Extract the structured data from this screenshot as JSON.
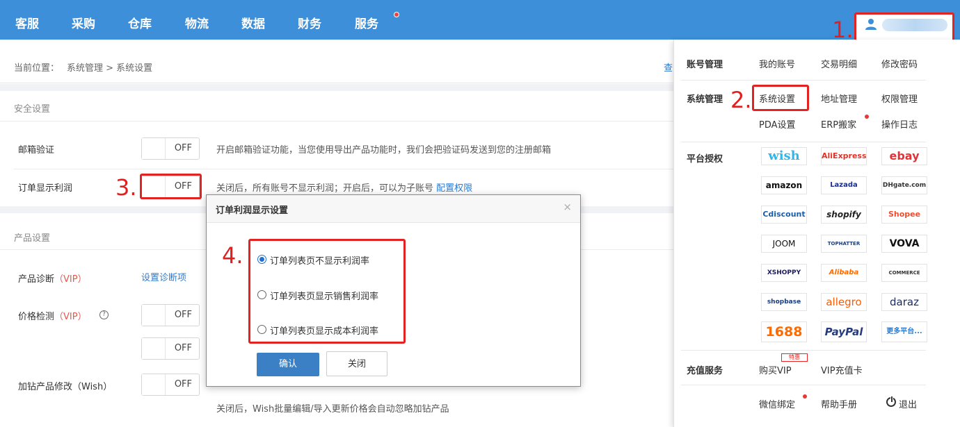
{
  "nav": {
    "items": [
      "客服",
      "采购",
      "仓库",
      "物流",
      "数据",
      "财务",
      "服务"
    ]
  },
  "annotations": {
    "step1": "1.",
    "step2": "2.",
    "step3": "3.",
    "step4": "4."
  },
  "breadcrumb": {
    "prefix": "当前位置：",
    "path": "系统管理 > 系统设置",
    "right_link": "查"
  },
  "security": {
    "title": "安全设置",
    "rows": [
      {
        "label": "邮箱验证",
        "toggle": "OFF",
        "desc": "开启邮箱验证功能，当您使用导出产品功能时，我们会把验证码发送到您的注册邮箱"
      },
      {
        "label": "订单显示利润",
        "toggle": "OFF",
        "desc": "关闭后，所有账号不显示利润；开启后，可以为子账号",
        "link": "配置权限"
      }
    ]
  },
  "product": {
    "title": "产品设置",
    "diag_label": "产品诊断",
    "diag_vip": "（VIP）",
    "diag_link": "设置诊断项",
    "price_label": "价格检测",
    "price_vip": "（VIP）",
    "price_toggle1": "OFF",
    "price_toggle2": "OFF",
    "wish_label": "加钻产品修改（Wish）",
    "wish_toggle": "OFF",
    "wish_desc": "关闭后，Wish批量编辑/导入更新价格会自动忽略加钻产品"
  },
  "modal": {
    "title": "订单利润显示设置",
    "close": "×",
    "options": [
      "订单列表页不显示利润率",
      "订单列表页显示销售利润率",
      "订单列表页显示成本利润率"
    ],
    "selected_index": 0,
    "confirm": "确认",
    "cancel": "关闭"
  },
  "menu": {
    "account_label": "账号管理",
    "account_items": [
      "我的账号",
      "交易明细",
      "修改密码"
    ],
    "system_label": "系统管理",
    "system_items": [
      "系统设置",
      "地址管理",
      "权限管理",
      "PDA设置",
      "ERP搬家",
      "操作日志"
    ],
    "platform_label": "平台授权",
    "platforms": [
      "wish",
      "AliExpress",
      "ebay",
      "amazon",
      "Lazada",
      "DHgate.com",
      "Cdiscount",
      "shopify",
      "Shopee",
      "JOOM",
      "TOPHATTER",
      "VOVA",
      "XSHOPPY",
      "Alibaba",
      "COMMERCE",
      "shopbase",
      "allegro",
      "daraz",
      "1688",
      "PayPal",
      "更多平台..."
    ],
    "recharge_label": "充值服务",
    "recharge_items": [
      "购买VIP",
      "VIP充值卡"
    ],
    "vip_badge": "特惠",
    "bottom_items": [
      "微信绑定",
      "帮助手册",
      "退出"
    ]
  },
  "colors": {
    "topbar": "#3c8fd8",
    "annotation": "#e02020",
    "primary_button": "#3b7fc5",
    "vip_text": "#e25a4d"
  }
}
